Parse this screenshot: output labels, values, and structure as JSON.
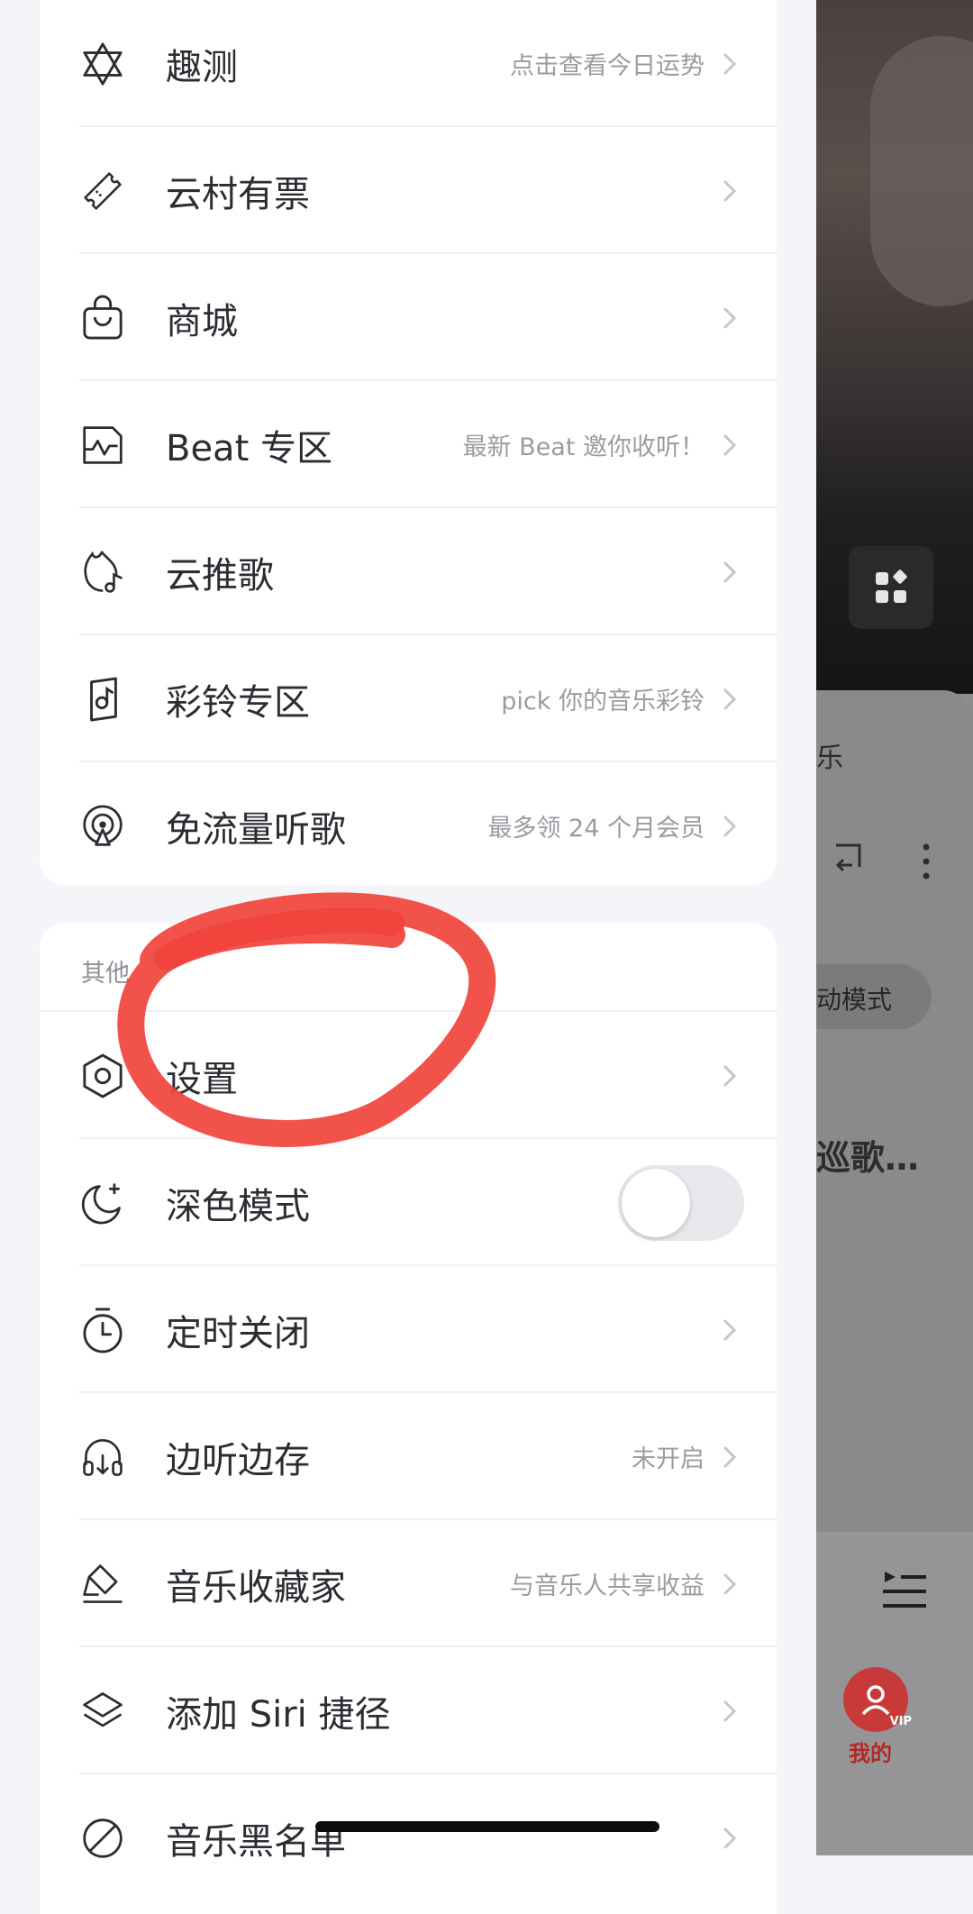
{
  "menu_top": {
    "items": [
      {
        "label": "趣测",
        "sub": "点击查看今日运势",
        "icon": "hexagram-icon"
      },
      {
        "label": "云村有票",
        "sub": "",
        "icon": "ticket-icon"
      },
      {
        "label": "商城",
        "sub": "",
        "icon": "shopping-bag-icon"
      },
      {
        "label": "Beat 专区",
        "sub": "最新 Beat 邀你收听！",
        "icon": "beat-icon"
      },
      {
        "label": "云推歌",
        "sub": "",
        "icon": "flame-note-icon"
      },
      {
        "label": "彩铃专区",
        "sub": "pick 你的音乐彩铃",
        "icon": "ringtone-icon"
      },
      {
        "label": "免流量听歌",
        "sub": "最多领 24 个月会员",
        "icon": "podcast-signal-icon"
      }
    ]
  },
  "menu_other": {
    "title": "其他",
    "items": [
      {
        "label": "设置",
        "sub": "",
        "icon": "settings-hexagon-icon"
      },
      {
        "label": "深色模式",
        "sub": "",
        "icon": "moon-icon",
        "toggle": "off"
      },
      {
        "label": "定时关闭",
        "sub": "",
        "icon": "timer-icon"
      },
      {
        "label": "边听边存",
        "sub": "未开启",
        "icon": "headphones-download-icon"
      },
      {
        "label": "音乐收藏家",
        "sub": "与音乐人共享收益",
        "icon": "collector-icon"
      },
      {
        "label": "添加 Siri 捷径",
        "sub": "",
        "icon": "layers-icon"
      },
      {
        "label": "音乐黑名单",
        "sub": "",
        "icon": "block-icon"
      }
    ]
  },
  "background": {
    "fragment_1": "乐",
    "fragment_2": "动模式",
    "fragment_3": "巡歌…",
    "tab_mine": "我的",
    "vip_badge": "VIP"
  },
  "colors": {
    "annotation_red": "#f0433b",
    "accent_red": "#c83a3a"
  }
}
